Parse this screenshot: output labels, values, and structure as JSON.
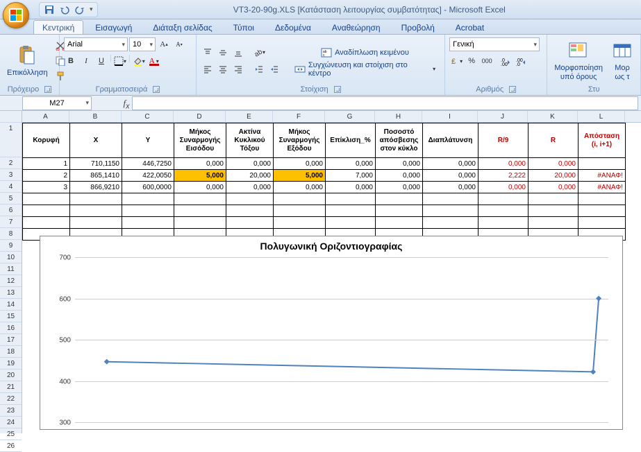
{
  "title": "VT3-20-90g.XLS  [Κατάσταση λειτουργίας συμβατότητας] - Microsoft Excel",
  "tabs": [
    "Κεντρική",
    "Εισαγωγή",
    "Διάταξη σελίδας",
    "Τύποι",
    "Δεδομένα",
    "Αναθεώρηση",
    "Προβολή",
    "Acrobat"
  ],
  "active_tab": 0,
  "ribbon": {
    "clipboard": {
      "paste": "Επικόλληση",
      "label": "Πρόχειρο"
    },
    "font": {
      "name": "Arial",
      "size": "10",
      "label": "Γραμματοσειρά",
      "bold": "B",
      "italic": "I",
      "underline": "U"
    },
    "alignment": {
      "wrap": "Αναδίπλωση κειμένου",
      "merge": "Συγχώνευση και στοίχιση στο κέντρο",
      "label": "Στοίχιση"
    },
    "number": {
      "format": "Γενική",
      "label": "Αριθμός",
      "pct": "%",
      "comma": "000"
    },
    "styles": {
      "cond": "Μορφοποίηση υπό όρους",
      "fmt": "Μορ\nως τ",
      "label": "Στυ"
    }
  },
  "namebox": "M27",
  "formula": "",
  "col_headers": [
    "A",
    "B",
    "C",
    "D",
    "E",
    "F",
    "G",
    "H",
    "I",
    "J",
    "K",
    "L"
  ],
  "row_count": 26,
  "table": {
    "headers": [
      "Κορυφή",
      "X",
      "Y",
      "Μήκος Συναρμογής Εισόδου",
      "Ακτίνα Κυκλικού Τόξου",
      "Μήκος Συναρμογής Εξόδου",
      "Επίκλιση_%",
      "Ποσοστό απόσβεσης στον κύκλο",
      "Διαπλάτυνση",
      "R/9",
      "R",
      "Απόσταση (i, i+1)"
    ],
    "rows": [
      {
        "k": "1",
        "x": "710,1150",
        "y": "446,7250",
        "d": "0,000",
        "e": "0,000",
        "f": "0,000",
        "g": "0,000",
        "h": "0,000",
        "i": "0,000",
        "j": "0,000",
        "k2": "0,000",
        "l": ""
      },
      {
        "k": "2",
        "x": "865,1410",
        "y": "422,0050",
        "d": "5,000",
        "e": "20,000",
        "f": "5,000",
        "g": "7,000",
        "h": "0,000",
        "i": "0,000",
        "j": "2,222",
        "k2": "20,000",
        "l": "#ΑΝΑΦ!"
      },
      {
        "k": "3",
        "x": "866,9210",
        "y": "600,0000",
        "d": "0,000",
        "e": "0,000",
        "f": "0,000",
        "g": "0,000",
        "h": "0,000",
        "i": "0,000",
        "j": "0,000",
        "k2": "0,000",
        "l": "#ΑΝΑΦ!"
      }
    ]
  },
  "chart_data": {
    "type": "line",
    "title": "Πολυγωνική Οριζοντιογραφίας",
    "x": [
      710.115,
      865.141,
      866.921
    ],
    "y": [
      446.725,
      422.005,
      600.0
    ],
    "series": [
      {
        "name": "",
        "values": [
          446.725,
          422.005,
          600.0
        ]
      }
    ],
    "ylim": [
      300,
      700
    ],
    "yticks": [
      300,
      400,
      500,
      600,
      700
    ],
    "xlabel": "",
    "ylabel": ""
  }
}
